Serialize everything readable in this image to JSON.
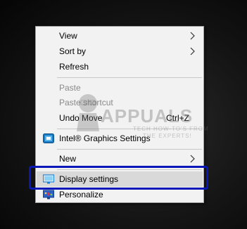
{
  "menu": {
    "items": [
      {
        "label": "View",
        "submenu": true,
        "disabled": false
      },
      {
        "label": "Sort by",
        "submenu": true,
        "disabled": false
      },
      {
        "label": "Refresh",
        "submenu": false,
        "disabled": false
      },
      {
        "label": "Paste",
        "submenu": false,
        "disabled": true
      },
      {
        "label": "Paste shortcut",
        "submenu": false,
        "disabled": true
      },
      {
        "label": "Undo Move",
        "shortcut": "Ctrl+Z",
        "submenu": false,
        "disabled": false
      },
      {
        "label": "Intel® Graphics Settings",
        "icon": "intel-graphics-icon",
        "submenu": false,
        "disabled": false
      },
      {
        "label": "New",
        "submenu": true,
        "disabled": false
      },
      {
        "label": "Display settings",
        "icon": "display-icon",
        "submenu": false,
        "disabled": false,
        "highlighted": true
      },
      {
        "label": "Personalize",
        "icon": "personalize-icon",
        "submenu": false,
        "disabled": false
      }
    ]
  },
  "watermark": {
    "brand": "APPUALS",
    "tagline_1": "TECH HOW-TO'S FROM",
    "tagline_2": "THE EXPERTS!"
  },
  "colors": {
    "menu_background": "#f2f2f2",
    "highlight_background": "#d9d9d9",
    "focus_outline": "#0818b8",
    "disabled_text": "#8a8a8a"
  }
}
